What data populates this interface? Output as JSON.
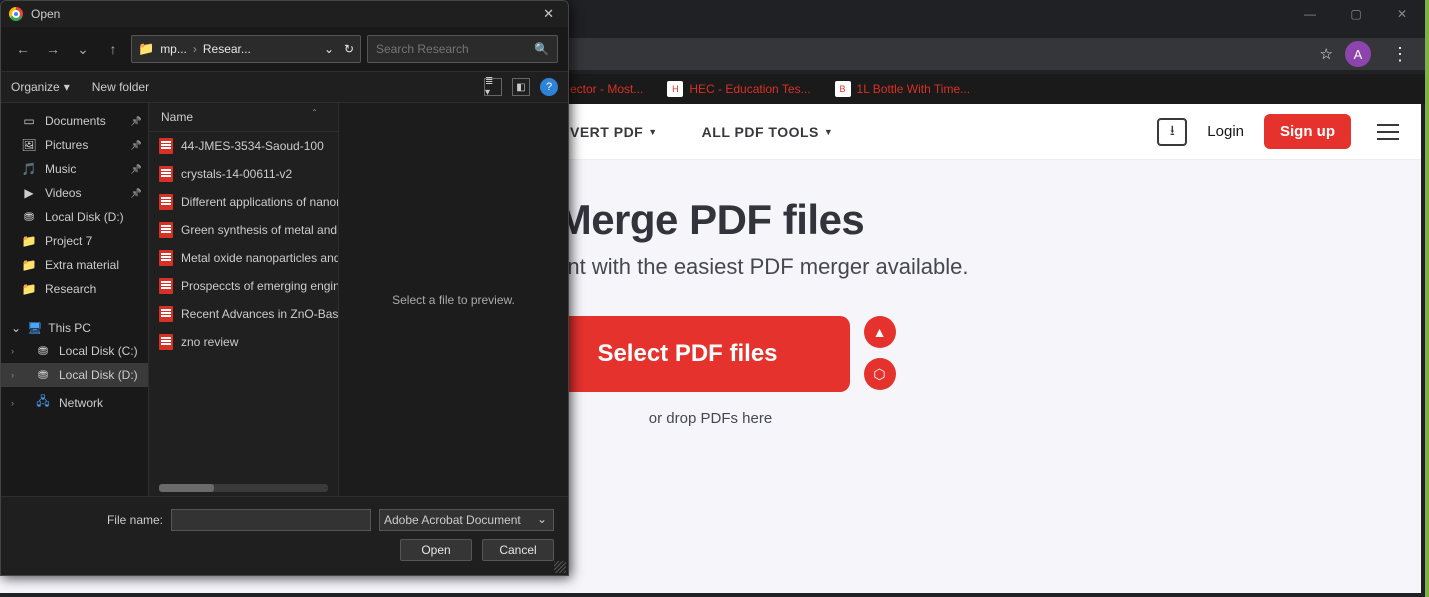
{
  "browser": {
    "window_buttons": {
      "min": "—",
      "max": "▢",
      "close": "✕"
    },
    "avatar_letter": "A",
    "bookmarks": [
      {
        "label": "ector - Most...",
        "icon": ""
      },
      {
        "label": "HEC - Education Tes...",
        "icon": "H"
      },
      {
        "label": "1L Bottle With Time...",
        "icon": "B"
      }
    ],
    "nav": {
      "item1": "VERT PDF",
      "item2": "ALL PDF TOOLS",
      "login": "Login",
      "signup": "Sign up"
    },
    "page": {
      "title": "Merge PDF files",
      "subtitle": "rder you want with the easiest PDF merger available.",
      "select_btn": "Select PDF files",
      "drop": "or drop PDFs here"
    }
  },
  "dialog": {
    "title": "Open",
    "breadcrumb": {
      "seg1": "mp...",
      "seg2": "Resear..."
    },
    "search_placeholder": "Search Research",
    "toolbar": {
      "organize": "Organize",
      "new_folder": "New folder"
    },
    "sidebar": {
      "quick": [
        {
          "icon": "▭",
          "label": "Documents",
          "pinned": true,
          "cls": "drive-ico"
        },
        {
          "icon": "🖼",
          "label": "Pictures",
          "pinned": true
        },
        {
          "icon": "🎵",
          "label": "Music",
          "pinned": true,
          "cls": ""
        },
        {
          "icon": "▶",
          "label": "Videos",
          "pinned": true
        },
        {
          "icon": "⛃",
          "label": "Local Disk (D:)",
          "pinned": false,
          "cls": "drive-ico"
        },
        {
          "icon": "📁",
          "label": "Project 7",
          "pinned": false,
          "cls": "folder-ico"
        },
        {
          "icon": "📁",
          "label": "Extra material",
          "pinned": false,
          "cls": "folder-ico"
        },
        {
          "icon": "📁",
          "label": "Research",
          "pinned": false,
          "cls": "folder-ico"
        }
      ],
      "this_pc": "This PC",
      "drives": [
        {
          "label": "Local Disk (C:)"
        },
        {
          "label": "Local Disk (D:)"
        }
      ],
      "network": "Network"
    },
    "file_header": "Name",
    "files": [
      "44-JMES-3534-Saoud-100",
      "crystals-14-00611-v2",
      "Different applications of nanor",
      "Green synthesis of metal and m",
      "Metal oxide nanoparticles and",
      "Prospeccts of emerging engine",
      "Recent Advances in ZnO-Based",
      "zno review"
    ],
    "preview_hint": "Select a file to preview.",
    "file_name_label": "File name:",
    "filter": "Adobe Acrobat Document",
    "open_btn": "Open",
    "cancel_btn": "Cancel"
  }
}
